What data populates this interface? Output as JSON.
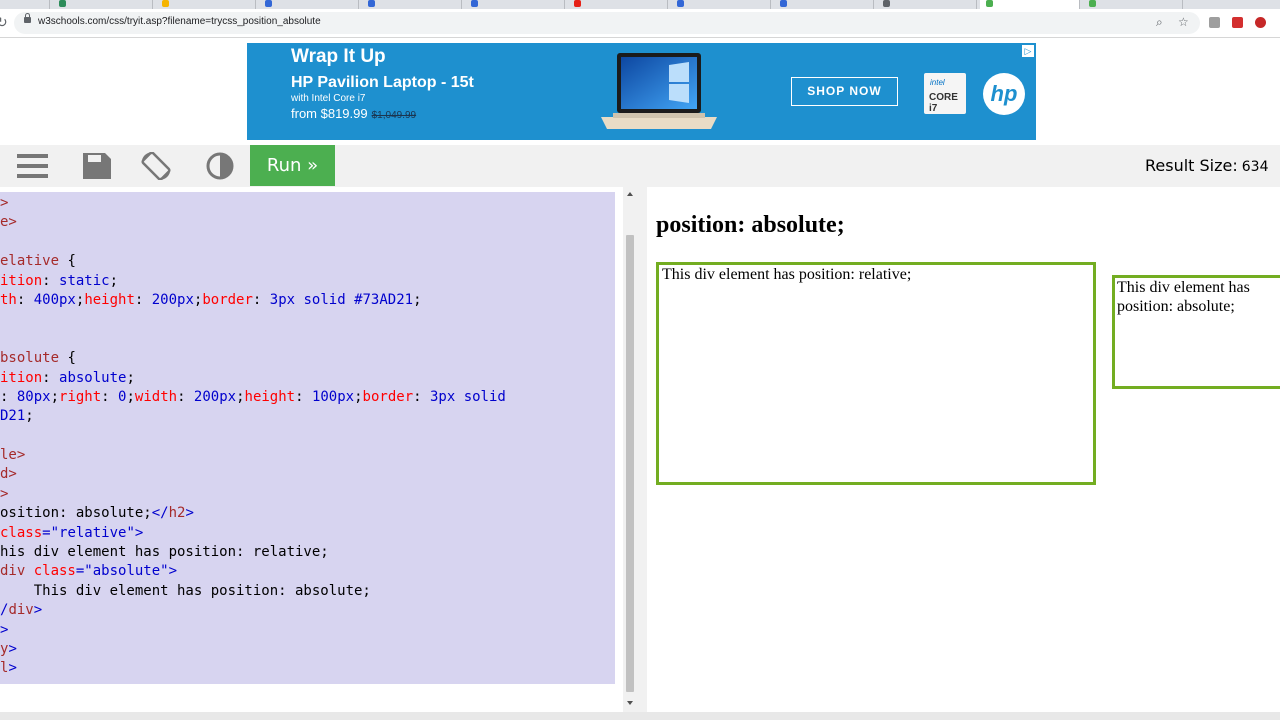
{
  "browser": {
    "url": "w3schools.com/css/tryit.asp?filename=trycss_position_absolute",
    "tabs": [
      {
        "label": "",
        "color": "#888888"
      },
      {
        "label": "",
        "color": "#2d8c5a"
      },
      {
        "label": "",
        "color": "#f5b400"
      },
      {
        "label": "",
        "color": "#3367d6"
      },
      {
        "label": "",
        "color": "#3367d6"
      },
      {
        "label": "",
        "color": "#3367d6"
      },
      {
        "label": "",
        "color": "#e62117"
      },
      {
        "label": "",
        "color": "#3367d6"
      },
      {
        "label": "",
        "color": "#3367d6"
      },
      {
        "label": "",
        "color": "#5f6368"
      },
      {
        "label": "",
        "color": "#4caf50"
      },
      {
        "label": "",
        "color": "#4caf50"
      }
    ]
  },
  "ad": {
    "headline": "Wrap It Up",
    "product": "HP Pavilion Laptop - 15t",
    "subline": "with Intel Core i7",
    "price_prefix": "from $819.99",
    "old_price": "$1,049.99",
    "cta": "SHOP NOW",
    "intel_top": "intel",
    "intel_bottom": "CORE i7",
    "brand": "hp",
    "badge": "▷"
  },
  "toolbar": {
    "run_label": "Run »",
    "result_size_label": "Result Size:",
    "result_size_value": "634",
    "icons": [
      "menu-icon",
      "save-icon",
      "rotate-icon",
      "contrast-icon"
    ]
  },
  "editor": {
    "lines": [
      [
        {
          "t": ">",
          "c": "#a52a2a"
        }
      ],
      [
        {
          "t": "e>",
          "c": "#a52a2a"
        }
      ],
      [],
      [
        {
          "t": "elative",
          "c": "#a52a2a"
        },
        {
          "t": " {",
          "c": "#000000"
        }
      ],
      [
        {
          "t": "ition",
          "c": "#ff0000"
        },
        {
          "t": ": ",
          "c": "#000000"
        },
        {
          "t": "static",
          "c": "#0000cd"
        },
        {
          "t": ";",
          "c": "#000000"
        }
      ],
      [
        {
          "t": "th",
          "c": "#ff0000"
        },
        {
          "t": ": ",
          "c": "#000000"
        },
        {
          "t": "400px",
          "c": "#0000cd"
        },
        {
          "t": ";",
          "c": "#000000"
        },
        {
          "t": "height",
          "c": "#ff0000"
        },
        {
          "t": ": ",
          "c": "#000000"
        },
        {
          "t": "200px",
          "c": "#0000cd"
        },
        {
          "t": ";",
          "c": "#000000"
        },
        {
          "t": "border",
          "c": "#ff0000"
        },
        {
          "t": ": ",
          "c": "#000000"
        },
        {
          "t": "3px solid #73AD21",
          "c": "#0000cd"
        },
        {
          "t": ";",
          "c": "#000000"
        }
      ],
      [],
      [],
      [
        {
          "t": "bsolute",
          "c": "#a52a2a"
        },
        {
          "t": " {",
          "c": "#000000"
        }
      ],
      [
        {
          "t": "ition",
          "c": "#ff0000"
        },
        {
          "t": ": ",
          "c": "#000000"
        },
        {
          "t": "absolute",
          "c": "#0000cd"
        },
        {
          "t": ";",
          "c": "#000000"
        }
      ],
      [
        {
          "t": ": ",
          "c": "#000000"
        },
        {
          "t": "80px",
          "c": "#0000cd"
        },
        {
          "t": ";",
          "c": "#000000"
        },
        {
          "t": "right",
          "c": "#ff0000"
        },
        {
          "t": ": ",
          "c": "#000000"
        },
        {
          "t": "0",
          "c": "#0000cd"
        },
        {
          "t": ";",
          "c": "#000000"
        },
        {
          "t": "width",
          "c": "#ff0000"
        },
        {
          "t": ": ",
          "c": "#000000"
        },
        {
          "t": "200px",
          "c": "#0000cd"
        },
        {
          "t": ";",
          "c": "#000000"
        },
        {
          "t": "height",
          "c": "#ff0000"
        },
        {
          "t": ": ",
          "c": "#000000"
        },
        {
          "t": "100px",
          "c": "#0000cd"
        },
        {
          "t": ";",
          "c": "#000000"
        },
        {
          "t": "border",
          "c": "#ff0000"
        },
        {
          "t": ": ",
          "c": "#000000"
        },
        {
          "t": "3px solid",
          "c": "#0000cd"
        }
      ],
      [
        {
          "t": "D21",
          "c": "#0000cd"
        },
        {
          "t": ";",
          "c": "#000000"
        }
      ],
      [],
      [
        {
          "t": "le>",
          "c": "#a52a2a"
        }
      ],
      [
        {
          "t": "d>",
          "c": "#a52a2a"
        }
      ],
      [
        {
          "t": ">",
          "c": "#a52a2a"
        }
      ],
      [
        {
          "t": "osition: absolute;",
          "c": "#000000"
        },
        {
          "t": "</",
          "c": "#0000cd"
        },
        {
          "t": "h2",
          "c": "#a52a2a"
        },
        {
          "t": ">",
          "c": "#0000cd"
        }
      ],
      [
        {
          "t": "class",
          "c": "#ff0000"
        },
        {
          "t": "=\"relative\">",
          "c": "#0000cd"
        }
      ],
      [
        {
          "t": "his div element has position: relative;",
          "c": "#000000"
        }
      ],
      [
        {
          "t": "div ",
          "c": "#a52a2a"
        },
        {
          "t": "class",
          "c": "#ff0000"
        },
        {
          "t": "=\"absolute\">",
          "c": "#0000cd"
        }
      ],
      [
        {
          "t": "    This div element has position: absolute;",
          "c": "#000000"
        }
      ],
      [
        {
          "t": "/",
          "c": "#0000cd"
        },
        {
          "t": "div",
          "c": "#a52a2a"
        },
        {
          "t": ">",
          "c": "#0000cd"
        }
      ],
      [
        {
          "t": ">",
          "c": "#0000cd"
        }
      ],
      [
        {
          "t": "y",
          "c": "#a52a2a"
        },
        {
          "t": ">",
          "c": "#0000cd"
        }
      ],
      [
        {
          "t": "l",
          "c": "#a52a2a"
        },
        {
          "t": ">",
          "c": "#0000cd"
        }
      ]
    ],
    "indents": [
      0,
      0,
      0,
      0,
      0,
      0,
      0,
      0,
      0,
      0,
      0,
      0,
      0,
      0,
      0,
      0,
      0,
      0,
      0,
      0,
      0,
      0,
      0,
      0,
      0
    ]
  },
  "result": {
    "heading": "position: absolute;",
    "relative_text": "This div element has position: relative;",
    "absolute_text": "This div element has position: absolute;",
    "border_color": "#73AD21"
  }
}
